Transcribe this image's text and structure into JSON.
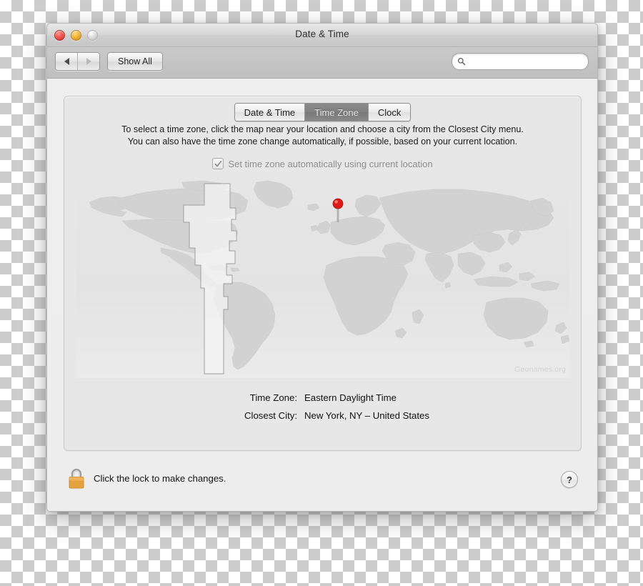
{
  "window": {
    "title": "Date & Time",
    "controls": {
      "close": "close-button",
      "minimize": "minimize-button",
      "zoom": "zoom-button"
    }
  },
  "toolbar": {
    "back_label": "◀",
    "forward_label": "▶",
    "show_all_label": "Show All",
    "search": {
      "value": "",
      "placeholder": ""
    }
  },
  "tabs": [
    {
      "label": "Date & Time",
      "active": false
    },
    {
      "label": "Time Zone",
      "active": true
    },
    {
      "label": "Clock",
      "active": false
    }
  ],
  "panel": {
    "instructions_line1": "To select a time zone, click the map near your location and choose a city from the Closest City menu.",
    "instructions_line2": "You can also have the time zone change automatically, if possible, based on your current location.",
    "auto_checkbox": {
      "label": "Set time zone automatically using current location",
      "checked": true,
      "enabled": false
    },
    "map": {
      "attribution": "Geonames.org",
      "pin": "location-pin"
    },
    "info": [
      {
        "label": "Time Zone:",
        "value": "Eastern Daylight Time"
      },
      {
        "label": "Closest City:",
        "value": "New York, NY – United States"
      }
    ]
  },
  "footer": {
    "lock_message": "Click the lock to make changes.",
    "lock_state": "locked",
    "help_label": "?"
  },
  "colors": {
    "accent_pin": "#e01b16",
    "lock_gold": "#efa845",
    "tab_active_bg": "#7f7f7f",
    "panel_bg": "#e7e7e7",
    "map_land": "#d2d2d2"
  }
}
